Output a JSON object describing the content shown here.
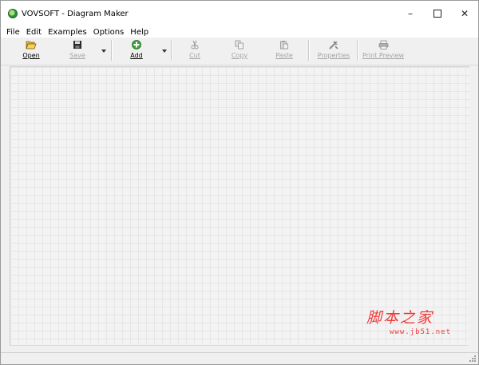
{
  "window": {
    "title": "VOVSOFT - Diagram Maker",
    "icon": "app-icon",
    "controls": {
      "minimize": "–",
      "close": "✕"
    }
  },
  "menu": {
    "file": "File",
    "edit": "Edit",
    "examples": "Examples",
    "options": "Options",
    "help": "Help"
  },
  "toolbar": {
    "open": "Open",
    "save": "Save",
    "add": "Add",
    "cut": "Cut",
    "copy": "Copy",
    "paste": "Paste",
    "properties": "Properties",
    "print_preview": "Print Preview",
    "disabled": [
      "Save",
      "Cut",
      "Copy",
      "Paste",
      "Properties",
      "Print Preview"
    ]
  },
  "watermark": {
    "chinese": "脚本之家",
    "url": "www.jb51.net",
    "color": "#ee3b3b"
  },
  "colors": {
    "window_bg": "#f0f0f0",
    "canvas_bg": "#f3f3f3",
    "disabled_text": "#a4a4a4"
  }
}
